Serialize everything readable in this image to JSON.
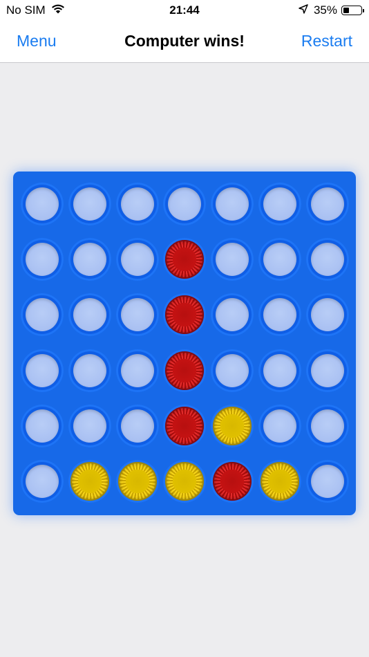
{
  "status_bar": {
    "carrier": "No SIM",
    "time": "21:44",
    "battery_percent": "35%",
    "battery_level": 0.35,
    "icons": [
      "wifi-icon",
      "location-arrow-icon",
      "battery-icon"
    ]
  },
  "nav": {
    "left_label": "Menu",
    "title": "Computer wins!",
    "right_label": "Restart"
  },
  "colors": {
    "accent": "#1a7cf0",
    "board": "#1769e8",
    "red_disc": "#d41a1a",
    "yellow_disc": "#e8c400"
  },
  "board": {
    "rows": 6,
    "columns": 7,
    "cells": [
      [
        "empty",
        "empty",
        "empty",
        "empty",
        "empty",
        "empty",
        "empty"
      ],
      [
        "empty",
        "empty",
        "empty",
        "red",
        "empty",
        "empty",
        "empty"
      ],
      [
        "empty",
        "empty",
        "empty",
        "red",
        "empty",
        "empty",
        "empty"
      ],
      [
        "empty",
        "empty",
        "empty",
        "red",
        "empty",
        "empty",
        "empty"
      ],
      [
        "empty",
        "empty",
        "empty",
        "red",
        "yellow",
        "empty",
        "empty"
      ],
      [
        "empty",
        "yellow",
        "yellow",
        "yellow",
        "red",
        "yellow",
        "empty"
      ]
    ]
  }
}
